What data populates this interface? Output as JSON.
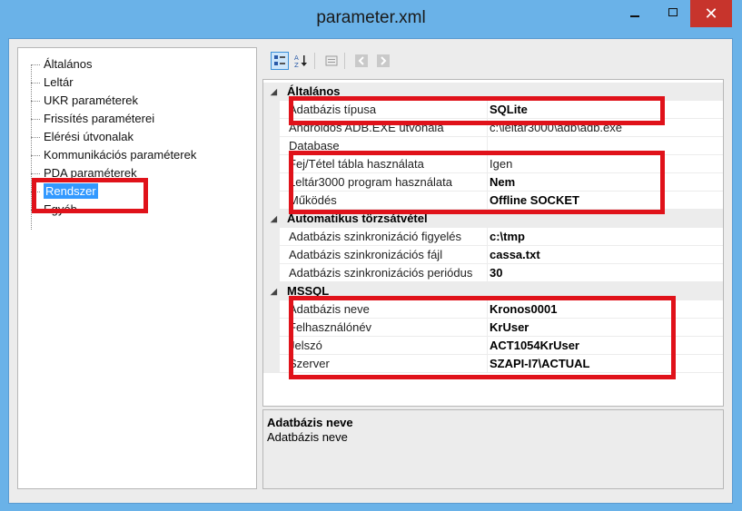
{
  "window": {
    "title": "parameter.xml",
    "minimize_glyph": "—",
    "maximize_glyph": "□",
    "close_glyph": "✕"
  },
  "tree": {
    "items": [
      {
        "label": "Általános"
      },
      {
        "label": "Leltár"
      },
      {
        "label": "UKR paraméterek"
      },
      {
        "label": "Frissítés paraméterei"
      },
      {
        "label": "Elérési útvonalak"
      },
      {
        "label": "Kommunikációs paraméterek"
      },
      {
        "label": "PDA paraméterek"
      },
      {
        "label": "Rendszer",
        "selected": true
      },
      {
        "label": "Egyéb"
      }
    ]
  },
  "toolbar": {
    "categorized_icon": "categorized-icon",
    "alphabetical_icon": "alphabetical-icon",
    "property_pages_icon": "property-pages-icon",
    "back_icon": "back-arrow-icon",
    "forward_icon": "forward-arrow-icon"
  },
  "grid": {
    "categories": [
      {
        "label": "Általános",
        "rows": [
          {
            "name": "Adatbázis típusa",
            "value": "SQLite"
          },
          {
            "name": "Androidos ADB.EXE útvonala",
            "value": "c:\\leltar3000\\adb\\adb.exe"
          },
          {
            "name": "Database",
            "value": ""
          },
          {
            "name": "Fej/Tétel tábla használata",
            "value": "Igen"
          },
          {
            "name": "Leltár3000 program használata",
            "value": "Nem"
          },
          {
            "name": "Működés",
            "value": "Offline SOCKET"
          }
        ]
      },
      {
        "label": "Automatikus törzsátvétel",
        "rows": [
          {
            "name": "Adatbázis szinkronizáció figyelés",
            "value": "c:\\tmp"
          },
          {
            "name": "Adatbázis szinkronizációs fájl",
            "value": "cassa.txt"
          },
          {
            "name": "Adatbázis szinkronizációs periódus",
            "value": "30"
          }
        ]
      },
      {
        "label": "MSSQL",
        "rows": [
          {
            "name": "Adatbázis neve",
            "value": "Kronos0001"
          },
          {
            "name": "Felhasználónév",
            "value": "KrUser"
          },
          {
            "name": "Jelszó",
            "value": "ACT1054KrUser"
          },
          {
            "name": "Szerver",
            "value": "SZAPI-I7\\ACTUAL"
          }
        ]
      }
    ]
  },
  "description": {
    "title": "Adatbázis neve",
    "text": "Adatbázis neve"
  },
  "colors": {
    "highlight": "#e0121a",
    "selection": "#3399ff",
    "close_button": "#c7342c",
    "window_frame": "#6ab2e8"
  }
}
